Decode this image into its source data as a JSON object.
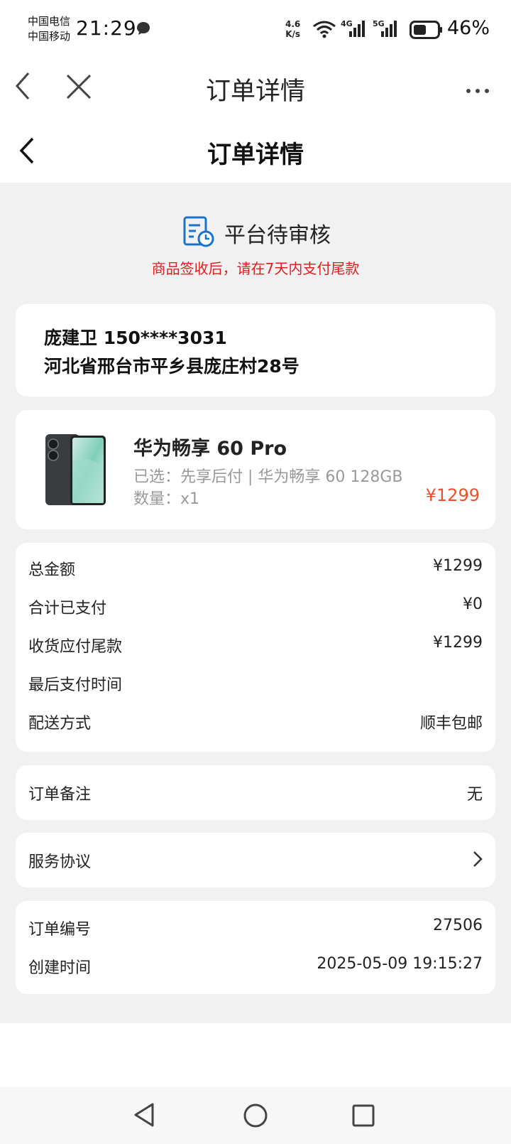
{
  "status_bar": {
    "carrier_1": "中国电信",
    "carrier_2": "中国移动",
    "time": "21:29",
    "net_speed_value": "4.6",
    "net_speed_unit": "K/s",
    "signal_1": "4G",
    "signal_2": "5G",
    "battery": "46%"
  },
  "browser_bar": {
    "title": "订单详情"
  },
  "header": {
    "title": "订单详情"
  },
  "order_status": {
    "title": "平台待审核",
    "notice": "商品签收后，请在7天内支付尾款"
  },
  "address": {
    "name_phone": "庞建卫 150****3031",
    "address": "河北省邢台市平乡县庞庄村28号"
  },
  "product": {
    "name": "华为畅享 60 Pro",
    "selected": "已选：先享后付 | 华为畅享 60 128GB",
    "quantity": "数量：x1",
    "price": "¥1299"
  },
  "fees": [
    {
      "label": "总金额",
      "value": "¥1299"
    },
    {
      "label": "合计已支付",
      "value": "¥0"
    },
    {
      "label": "收货应付尾款",
      "value": "¥1299"
    },
    {
      "label": "最后支付时间",
      "value": ""
    },
    {
      "label": "配送方式",
      "value": "顺丰包邮"
    }
  ],
  "remark": {
    "label": "订单备注",
    "value": "无"
  },
  "service": {
    "label": "服务协议"
  },
  "order_info": [
    {
      "label": "订单编号",
      "value": "27506"
    },
    {
      "label": "创建时间",
      "value": "2025-05-09 19:15:27"
    }
  ],
  "colors": {
    "accent_red": "#e02020",
    "price_orange": "#f0502a",
    "icon_blue": "#1a73c9",
    "page_bg": "#f1f1f1"
  },
  "icons": [
    "chat-icon",
    "wifi-icon",
    "battery-icon",
    "back-icon",
    "close-icon",
    "more-icon",
    "review-status-icon",
    "chevron-right-icon",
    "nav-back-icon",
    "nav-home-icon",
    "nav-recent-icon"
  ]
}
